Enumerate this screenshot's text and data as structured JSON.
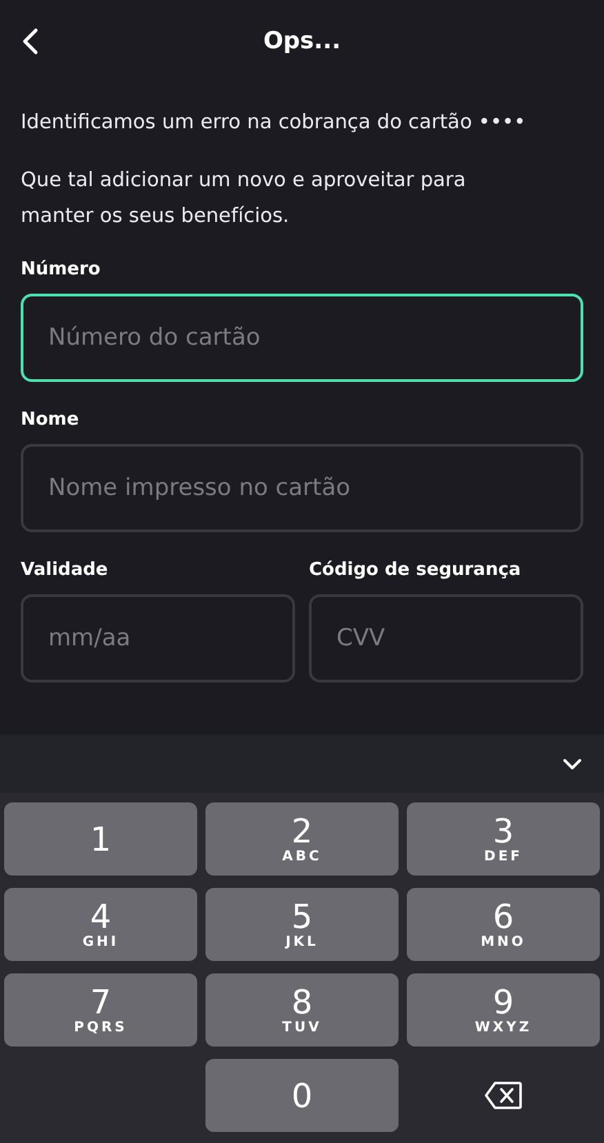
{
  "header": {
    "title": "Ops..."
  },
  "messages": [
    "Identificamos um erro na cobrança do cartão ••••",
    "Que tal adicionar um novo e aproveitar para manter os seus benefícios."
  ],
  "field_rows": [
    [
      {
        "label": "Número",
        "placeholder": "Número do cartão",
        "focused": true
      }
    ],
    [
      {
        "label": "Nome",
        "placeholder": "Nome impresso no cartão",
        "focused": false
      }
    ],
    [
      {
        "label": "Validade",
        "placeholder": "mm/aa",
        "focused": false
      },
      {
        "label": "Código de segurança",
        "placeholder": "CVV",
        "focused": false
      }
    ]
  ],
  "keypad": [
    {
      "kind": "digit",
      "digit": "1"
    },
    {
      "kind": "digit",
      "digit": "2",
      "letters": "ABC"
    },
    {
      "kind": "digit",
      "digit": "3",
      "letters": "DEF"
    },
    {
      "kind": "digit",
      "digit": "4",
      "letters": "GHI"
    },
    {
      "kind": "digit",
      "digit": "5",
      "letters": "JKL"
    },
    {
      "kind": "digit",
      "digit": "6",
      "letters": "MNO"
    },
    {
      "kind": "digit",
      "digit": "7",
      "letters": "PQRS"
    },
    {
      "kind": "digit",
      "digit": "8",
      "letters": "TUV"
    },
    {
      "kind": "digit",
      "digit": "9",
      "letters": "WXYZ"
    },
    {
      "kind": "blank"
    },
    {
      "kind": "digit",
      "digit": "0"
    },
    {
      "kind": "delete"
    }
  ]
}
